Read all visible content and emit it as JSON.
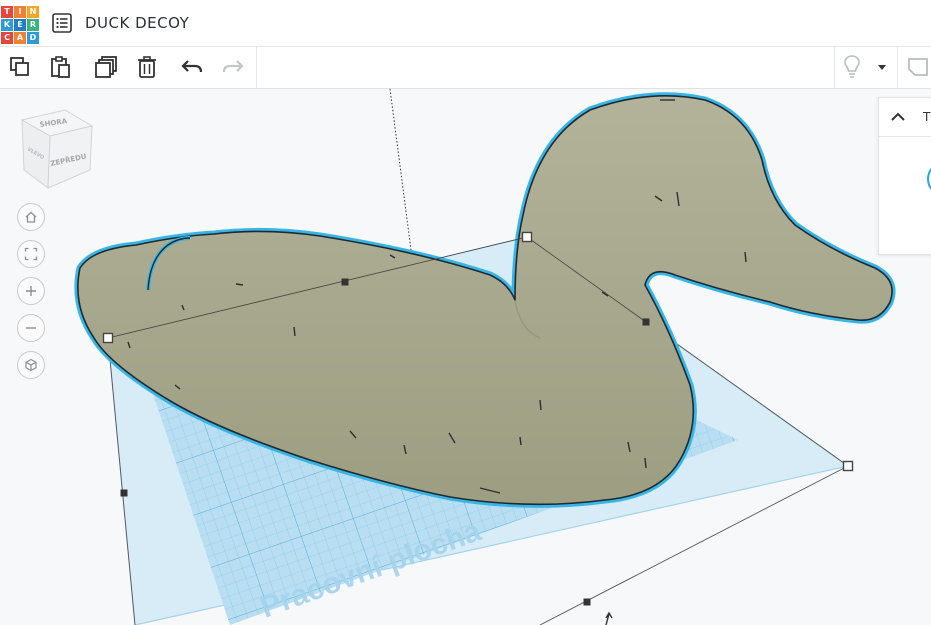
{
  "app": {
    "logo_letters": [
      "T",
      "I",
      "N",
      "K",
      "E",
      "R",
      "C",
      "A",
      "D"
    ],
    "logo_colors": [
      "#e8463d",
      "#f57f32",
      "#f5a623",
      "#2d9bd8",
      "#1f7fc0",
      "#36b37e",
      "#e8463d",
      "#f57f32",
      "#2d9bd8"
    ],
    "title": "DUCK DECOY"
  },
  "toolbar": {
    "buttons": [
      {
        "name": "copy-button",
        "icon": "copy-icon"
      },
      {
        "name": "paste-button",
        "icon": "paste-icon"
      },
      {
        "name": "duplicate-button",
        "icon": "duplicate-icon"
      },
      {
        "name": "delete-button",
        "icon": "trash-icon"
      },
      {
        "name": "undo-button",
        "icon": "undo-icon"
      },
      {
        "name": "redo-button",
        "icon": "redo-icon"
      }
    ],
    "right": [
      {
        "name": "light-button",
        "icon": "lightbulb-icon"
      },
      {
        "name": "light-dropdown",
        "icon": "caret-down-icon"
      },
      {
        "name": "note-button",
        "icon": "note-icon"
      }
    ]
  },
  "viewcube": {
    "top_label": "SHORA",
    "front_label": "ZEPŘEDU",
    "side_label": "VLEVO"
  },
  "nav_controls": [
    {
      "name": "home-view-button",
      "icon": "home-icon"
    },
    {
      "name": "fit-view-button",
      "icon": "fit-icon"
    },
    {
      "name": "zoom-in-button",
      "icon": "plus-icon"
    },
    {
      "name": "zoom-out-button",
      "icon": "minus-icon"
    },
    {
      "name": "perspective-button",
      "icon": "cube-icon"
    }
  ],
  "workplane": {
    "label": "Pracovní plocha"
  },
  "shape_panel": {
    "title": "T"
  },
  "colors": {
    "grid": "#7ec6e8",
    "selection_outline": "#38b5e6",
    "duck": "#a8a88d"
  }
}
